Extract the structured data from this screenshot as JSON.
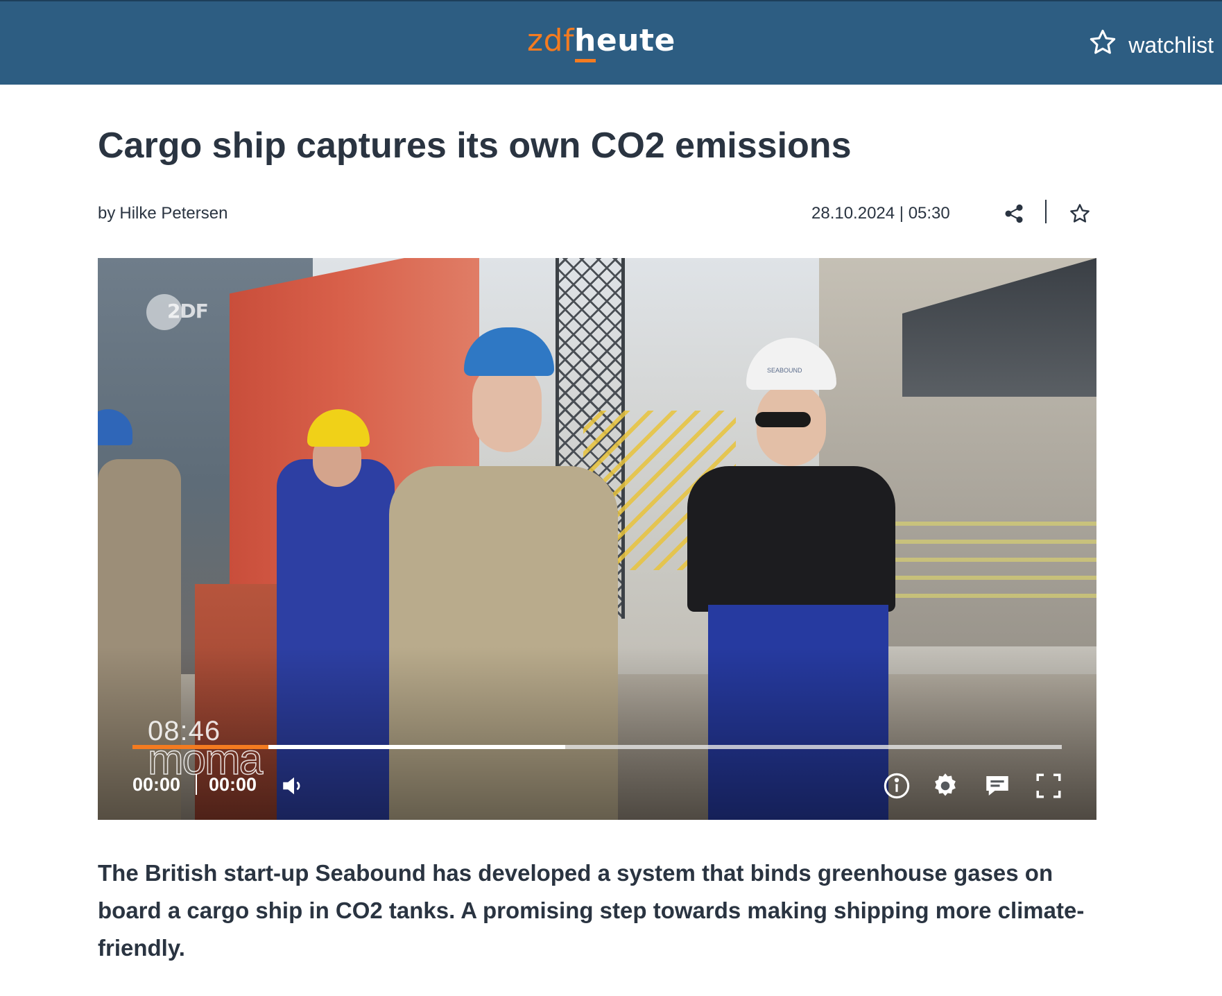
{
  "header": {
    "logo_zdf": "zdf",
    "logo_h": "h",
    "logo_heute_rest": "eute",
    "watchlist_label": "watchlist",
    "watchlist_icon": "star-outline-icon",
    "background_color": "#2d5d82",
    "accent_color": "#f47b20"
  },
  "article": {
    "title": "Cargo ship captures its own CO2 emissions",
    "author_prefix": "by",
    "author": "Hilke Petersen",
    "datetime": "28.10.2024 | 05:30",
    "share_icon": "share-icon",
    "bookmark_icon": "star-outline-icon",
    "teaser": "The British start-up Seabound has developed a system that binds greenhouse gases on board a cargo ship in CO2 tanks. A promising step towards making shipping more climate-friendly."
  },
  "video": {
    "channel_bug": "2DF",
    "overlay_clock": "08:46",
    "overlay_show": "moma",
    "helmet_text": "SEABOUND",
    "player": {
      "current_time": "00:00",
      "duration": "00:00",
      "played_fraction": 0.146,
      "buffered_fraction": 0.466,
      "controls": [
        "volume-icon",
        "info-icon",
        "settings-icon",
        "subtitles-icon",
        "fullscreen-icon"
      ]
    }
  }
}
